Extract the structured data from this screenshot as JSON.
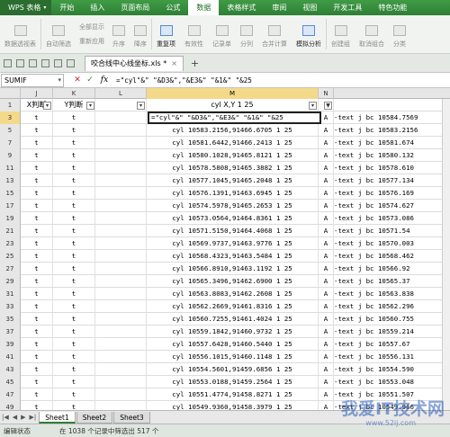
{
  "app": {
    "logo": "WPS 表格"
  },
  "menu": [
    "开始",
    "插入",
    "页面布局",
    "公式",
    "数据",
    "表格样式",
    "审阅",
    "视图",
    "开发工具",
    "特色功能"
  ],
  "ribbon": {
    "pivot": "数据透视表",
    "autofilter": "自动筛选",
    "show_all": "全部显示",
    "reapply": "重新应用",
    "sort_asc": "升序",
    "sort_desc": "降序",
    "duplicates": "重复项",
    "validity": "有效性",
    "record_form": "记录单",
    "split": "分列",
    "consolidate": "合并计算",
    "simulate": "模拟分析",
    "create_group": "创建组",
    "ungroup": "取消组合",
    "subtotal": "分类"
  },
  "tab": {
    "filename": "咬合线中心线坐标.xls *"
  },
  "formula_bar": {
    "name_box": "SUMIF",
    "formula": "=\"cyl\"&\" \"&D3&\",\"&E3&\" \"&1&\" \"&25"
  },
  "grid": {
    "columns": [
      "J",
      "K",
      "L",
      "M",
      "N"
    ],
    "selected_column": "M",
    "header_row": {
      "j": "X判断",
      "k": "Y判断",
      "m": "cyl X,Y 1 25"
    },
    "editing_text": "=\"cyl\"&\" \"&D3&\",\"&E3&\" \"&1&\" \"&25",
    "rows": [
      {
        "num": "1",
        "j": "X判断",
        "k": "Y判断",
        "m": "cyl X,Y 1 25",
        "n": "",
        "o": ""
      },
      {
        "num": "3",
        "j": "t",
        "k": "t",
        "m": "",
        "n": "A",
        "o": "-text j bc 10584.7569"
      },
      {
        "num": "5",
        "j": "t",
        "k": "t",
        "m": "cyl 10583.2156,91466.6705 1 25",
        "n": "A",
        "o": "-text j bc 10583.2156"
      },
      {
        "num": "7",
        "j": "t",
        "k": "t",
        "m": "cyl 10581.6442,91466.2413 1 25",
        "n": "A",
        "o": "-text j bc 10581.674"
      },
      {
        "num": "9",
        "j": "t",
        "k": "t",
        "m": "cyl 10580.1028,91465.8121 1 25",
        "n": "A",
        "o": "-text j bc 10580.132"
      },
      {
        "num": "11",
        "j": "t",
        "k": "t",
        "m": "cyl 10578.5808,91465.3882 1 25",
        "n": "A",
        "o": "-text j bc 10578.610"
      },
      {
        "num": "13",
        "j": "t",
        "k": "t",
        "m": "cyl 10577.1045,91465.2048 1 25",
        "n": "A",
        "o": "-text j bc 10577.134"
      },
      {
        "num": "15",
        "j": "t",
        "k": "t",
        "m": "cyl 10576.1391,91463.6945 1 25",
        "n": "A",
        "o": "-text j bc 10576.169"
      },
      {
        "num": "17",
        "j": "t",
        "k": "t",
        "m": "cyl 10574.5978,91465.2653 1 25",
        "n": "A",
        "o": "-text j bc 10574.627"
      },
      {
        "num": "19",
        "j": "t",
        "k": "t",
        "m": "cyl 10573.0564,91464.8361 1 25",
        "n": "A",
        "o": "-text j bc 10573.086"
      },
      {
        "num": "21",
        "j": "t",
        "k": "t",
        "m": "cyl 10571.5150,91464.4068 1 25",
        "n": "A",
        "o": "-text j bc 10571.54"
      },
      {
        "num": "23",
        "j": "t",
        "k": "t",
        "m": "cyl 10569.9737,91463.9776 1 25",
        "n": "A",
        "o": "-text j bc 10570.003"
      },
      {
        "num": "25",
        "j": "t",
        "k": "t",
        "m": "cyl 10568.4323,91463.5484 1 25",
        "n": "A",
        "o": "-text j bc 10568.462"
      },
      {
        "num": "27",
        "j": "t",
        "k": "t",
        "m": "cyl 10566.8910,91463.1192 1 25",
        "n": "A",
        "o": "-text j bc 10566.92"
      },
      {
        "num": "29",
        "j": "t",
        "k": "t",
        "m": "cyl 10565.3496,91462.6900 1 25",
        "n": "A",
        "o": "-text j bc 10565.37"
      },
      {
        "num": "31",
        "j": "t",
        "k": "t",
        "m": "cyl 10563.8083,91462.2608 1 25",
        "n": "A",
        "o": "-text j bc 10563.838"
      },
      {
        "num": "33",
        "j": "t",
        "k": "t",
        "m": "cyl 10562.2669,91461.8316 1 25",
        "n": "A",
        "o": "-text j bc 10562.296"
      },
      {
        "num": "35",
        "j": "t",
        "k": "t",
        "m": "cyl 10560.7255,91461.4024 1 25",
        "n": "A",
        "o": "-text j bc 10560.755"
      },
      {
        "num": "37",
        "j": "t",
        "k": "t",
        "m": "cyl 10559.1842,91460.9732 1 25",
        "n": "A",
        "o": "-text j bc 10559.214"
      },
      {
        "num": "39",
        "j": "t",
        "k": "t",
        "m": "cyl 10557.6428,91460.5440 1 25",
        "n": "A",
        "o": "-text j bc 10557.67"
      },
      {
        "num": "41",
        "j": "t",
        "k": "t",
        "m": "cyl 10556.1015,91460.1148 1 25",
        "n": "A",
        "o": "-text j bc 10556.131"
      },
      {
        "num": "43",
        "j": "t",
        "k": "t",
        "m": "cyl 10554.5601,91459.6856 1 25",
        "n": "A",
        "o": "-text j bc 10554.590"
      },
      {
        "num": "45",
        "j": "t",
        "k": "t",
        "m": "cyl 10553.0188,91459.2564 1 25",
        "n": "A",
        "o": "-text j bc 10553.048"
      },
      {
        "num": "47",
        "j": "t",
        "k": "t",
        "m": "cyl 10551.4774,91458.8271 1 25",
        "n": "A",
        "o": "-text j bc 10551.507"
      },
      {
        "num": "49",
        "j": "t",
        "k": "t",
        "m": "cyl 10549.9360,91458.3979 1 25",
        "n": "A",
        "o": "-text j bc 10549.966"
      }
    ]
  },
  "sheets": [
    "Sheet1",
    "Sheet2",
    "Sheet3"
  ],
  "status": {
    "mode": "编辑状态",
    "filter_info": "在 1038 个记录中筛选出 517 个"
  },
  "watermark": {
    "main": "我爱IT技术网",
    "url": "www.52ij.com"
  }
}
